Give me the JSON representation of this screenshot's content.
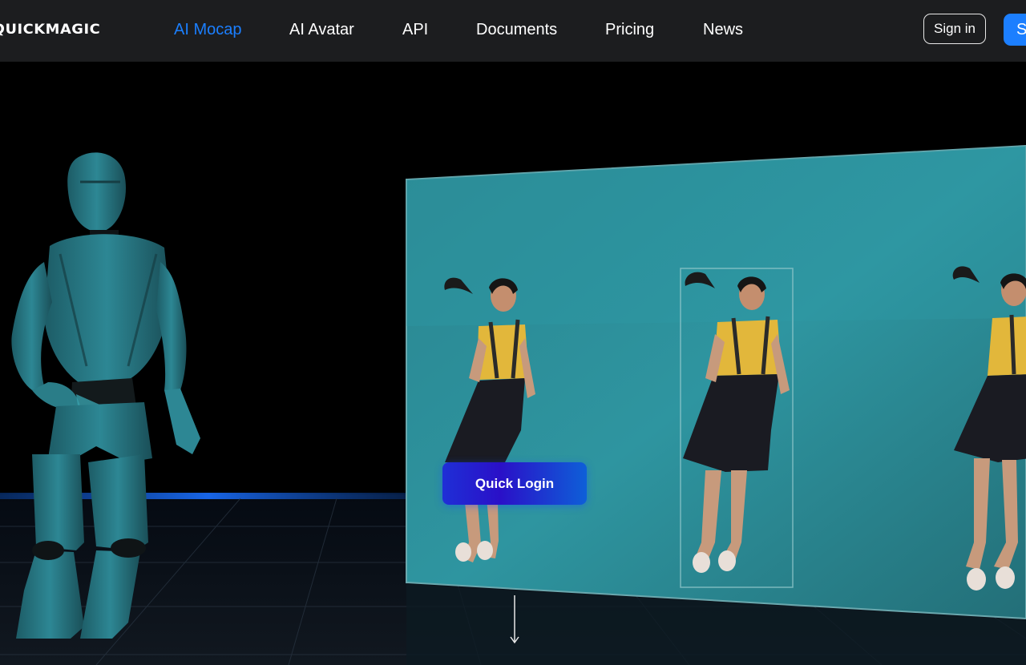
{
  "header": {
    "logo_text": "QUICKMAGIC",
    "nav": [
      {
        "label": "AI Mocap",
        "active": true
      },
      {
        "label": "AI Avatar",
        "active": false
      },
      {
        "label": "API",
        "active": false
      },
      {
        "label": "Documents",
        "active": false
      },
      {
        "label": "Pricing",
        "active": false
      },
      {
        "label": "News",
        "active": false
      }
    ],
    "signin_label": "Sign in",
    "signup_label": "S"
  },
  "hero": {
    "quick_login_label": "Quick Login",
    "scroll_icon": "arrow-down-icon"
  },
  "colors": {
    "topbar_bg": "#1c1d1f",
    "accent": "#1b7fff",
    "screen_teal": "#2c8e98",
    "robot_teal": "#2b7f8a",
    "shirt_yellow": "#e8b93a"
  }
}
